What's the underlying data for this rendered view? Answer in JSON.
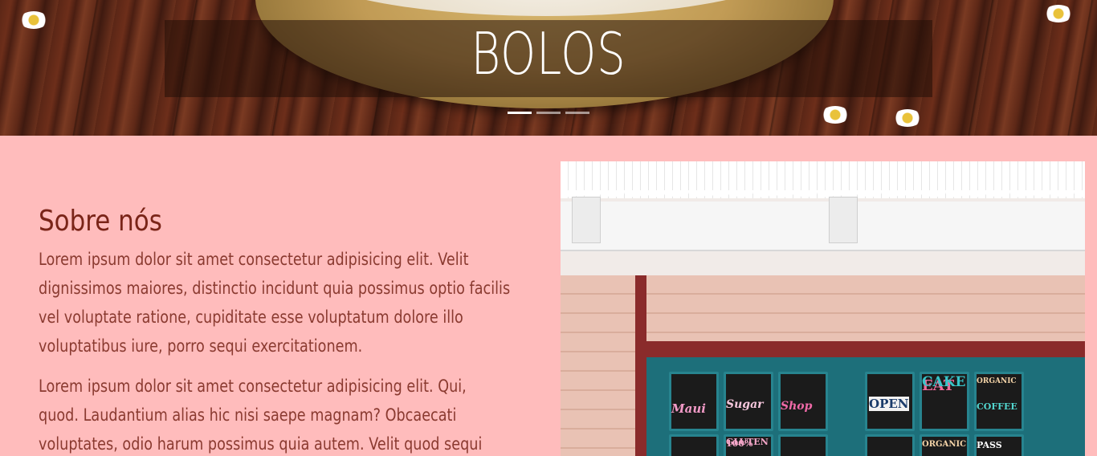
{
  "hero": {
    "title": "BOLOS",
    "carousel": {
      "slides": 3,
      "active_index": 0
    }
  },
  "about": {
    "heading": "Sobre nós",
    "paragraphs": [
      "Lorem ipsum dolor sit amet consectetur adipisicing elit. Velit dignissimos maiores, distinctio incidunt quia possimus optio facilis vel voluptate ratione, cupiditate esse voluptatum dolore illo voluptatibus iure, porro sequi exercitationem.",
      "Lorem ipsum dolor sit amet consectetur adipisicing elit. Qui, quod. Laudantium alias hic nisi saepe magnam? Obcaecati voluptates, odio harum possimus quia autem. Velit quod sequi"
    ]
  },
  "shop_signs": {
    "pane1": "Maui",
    "pane2": "Sugar",
    "pane3": "Shop",
    "pane4": "OPEN",
    "pane5a": "EAT",
    "pane5b": "CAKE",
    "pane6a": "ORGANIC",
    "pane6b": "COFFEE",
    "pane8": "100%",
    "pane8b": "GLUTEN",
    "pane10": "ORGANIC",
    "pane11": "PASS"
  },
  "colors": {
    "page_background": "#ffbcbc",
    "heading": "#7a2418",
    "body_text": "#8a3a30",
    "title_text": "#ffffff"
  }
}
